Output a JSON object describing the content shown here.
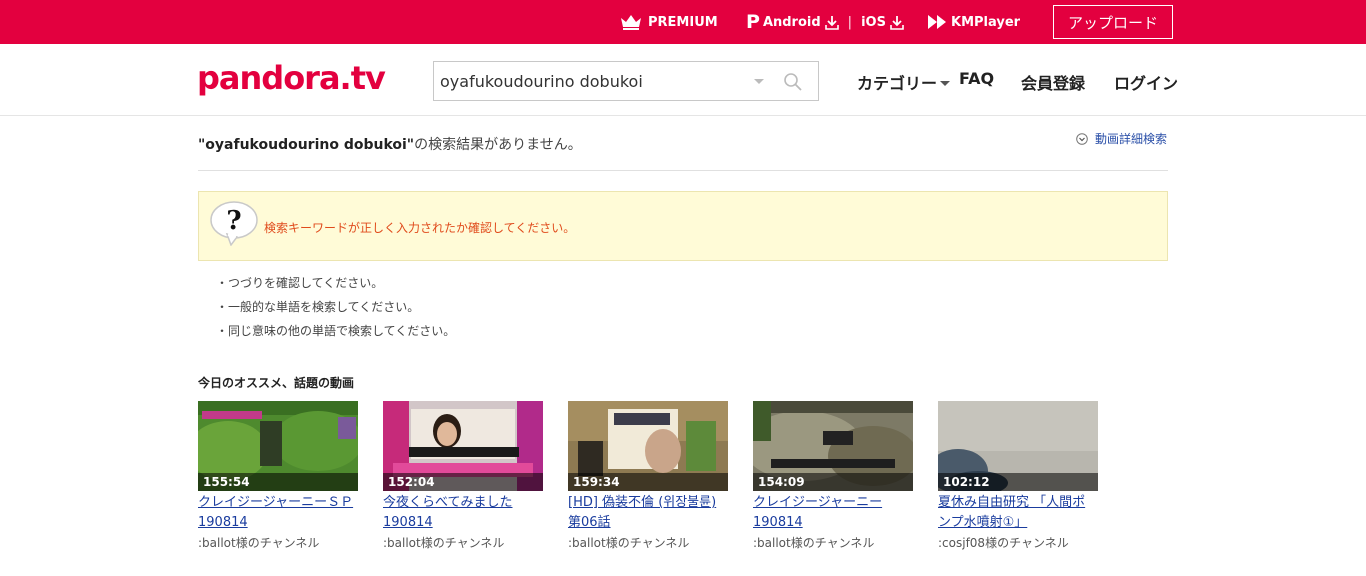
{
  "topbar": {
    "premium_label": "PREMIUM",
    "android_label": "Android",
    "ios_label": "iOS",
    "separator": "|",
    "kmplayer_label": "KMPlayer",
    "upload_label": "アップロード",
    "background_color": "#e3003f"
  },
  "header": {
    "logo": "pandora.tv",
    "search_value": "oyafukoudourino dobukoi",
    "nav": {
      "category": "カテゴリー",
      "faq": "FAQ",
      "signup": "会員登録",
      "login": "ログイン"
    }
  },
  "results": {
    "query_quoted": "\"oyafukoudourino dobukoi\"",
    "no_result_suffix": "の検索結果がありません。",
    "advanced_search": "動画詳細検索",
    "notice": "検索キーワードが正しく入力されたか確認してください。",
    "tips": [
      "・つづりを確認してください。",
      "・一般的な単語を検索してください。",
      "・同じ意味の他の単語で検索してください。"
    ]
  },
  "recommend": {
    "title": "今日のオススメ、話題の動画",
    "videos": [
      {
        "duration": "155:54",
        "title_line1": "クレイジージャーニーＳＰ",
        "title_line2": "190814",
        "channel": ":ballot様のチャンネル"
      },
      {
        "duration": "152:04",
        "title_line1": "今夜くらべてみました",
        "title_line2": "190814",
        "channel": ":ballot様のチャンネル"
      },
      {
        "duration": "159:34",
        "title_line1": "[HD] 偽装不倫 (위장불륜)",
        "title_line2": "第06話",
        "channel": ":ballot様のチャンネル"
      },
      {
        "duration": "154:09",
        "title_line1": "クレイジージャーニー",
        "title_line2": "190814",
        "channel": ":ballot様のチャンネル"
      },
      {
        "duration": "102:12",
        "title_line1": "夏休み自由研究 「人間ポ",
        "title_line2": "ンプ水噴射①」",
        "channel": ":cosjf08様のチャンネル"
      }
    ]
  },
  "colors": {
    "brand": "#e3003f",
    "link": "#1a3c9e",
    "notice_text": "#e04b1c",
    "notice_bg": "#fffbd7"
  },
  "icons": [
    "crown-icon",
    "download-icon",
    "kmplayer-logo-icon",
    "search-icon",
    "chevron-down-icon",
    "question-bubble-icon"
  ]
}
